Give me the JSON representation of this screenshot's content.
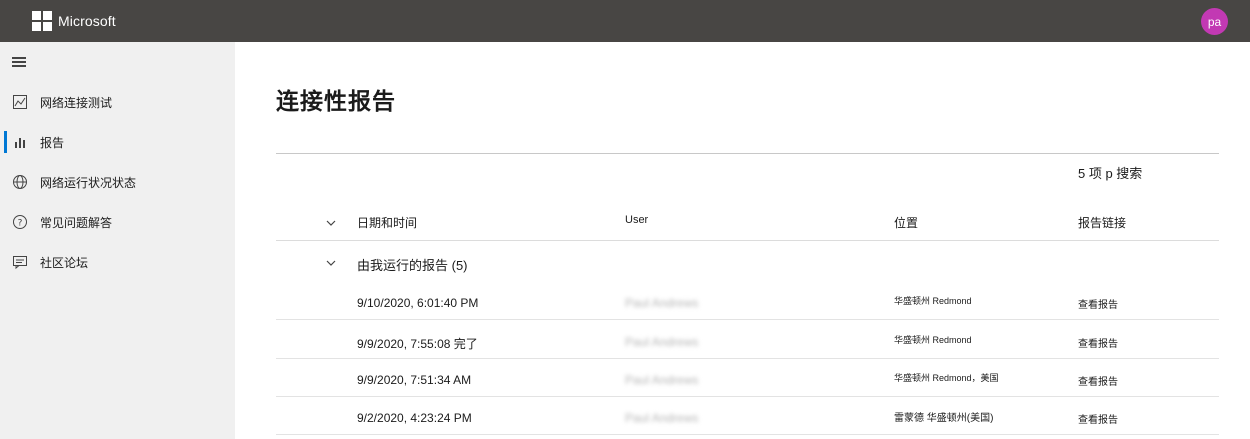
{
  "header": {
    "brand": "Microsoft",
    "avatar_initials": "pa",
    "avatar_color": "#c239b3",
    "bar_color": "#484644"
  },
  "sidebar": {
    "items": [
      {
        "label": "网络连接测试",
        "icon": "chart-line-icon",
        "active": false
      },
      {
        "label": "报告",
        "icon": "bar-chart-icon",
        "active": true
      },
      {
        "label": "网络运行状况状态",
        "icon": "globe-network-icon",
        "active": false
      },
      {
        "label": "常见问题解答",
        "icon": "help-circle-icon",
        "active": false
      },
      {
        "label": "社区论坛",
        "icon": "comment-icon",
        "active": false
      }
    ],
    "accent_color": "#0078d4"
  },
  "main": {
    "title": "连接性报告",
    "search_info": "5 项 p 搜索",
    "columns": {
      "date": "日期和时间",
      "user": "User",
      "location": "位置",
      "link": "报告链接"
    },
    "group_label": "由我运行的报告 (5)",
    "rows": [
      {
        "date": "9/10/2020, 6:01:40 PM",
        "user": "Paul Andrews",
        "location": "华盛顿州 Redmond",
        "link": "查看报告"
      },
      {
        "date": "9/9/2020, 7:55:08 完了",
        "user": "Paul Andrews",
        "location": "华盛顿州 Redmond",
        "link": "查看报告"
      },
      {
        "date": "9/9/2020, 7:51:34 AM",
        "user": "Paul Andrews",
        "location": "华盛顿州 Redmond，美国",
        "link": "查看报告"
      },
      {
        "date": "9/2/2020, 4:23:24 PM",
        "user": "Paul Andrews",
        "location": "雷蒙德 华盛顿州(美国)",
        "link": "查看报告"
      }
    ]
  }
}
